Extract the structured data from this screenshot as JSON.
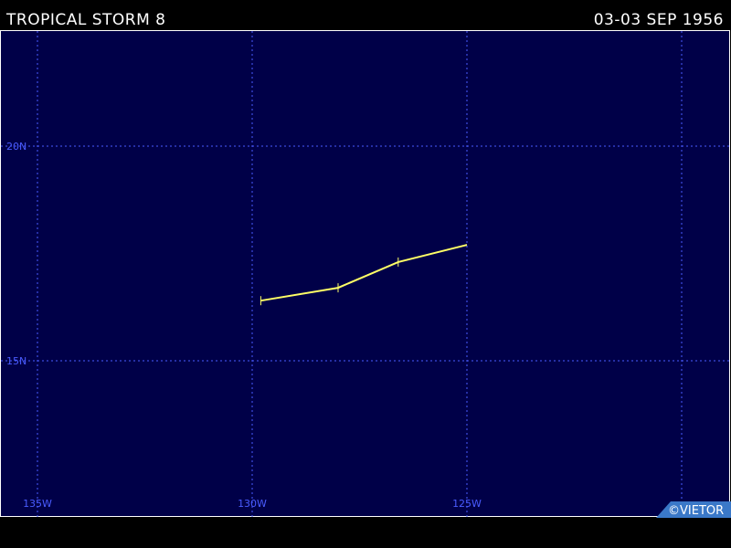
{
  "header": {
    "storm_name": "TROPICAL STORM 8",
    "date_range": "03-03 SEP 1956"
  },
  "map": {
    "lon_grid": [
      {
        "value": -135,
        "label": "135W"
      },
      {
        "value": -130,
        "label": "130W"
      },
      {
        "value": -125,
        "label": "125W"
      },
      {
        "value": -120,
        "label": ""
      }
    ],
    "lat_grid": [
      {
        "value": 20,
        "label": "20N"
      },
      {
        "value": 15,
        "label": "15N"
      }
    ],
    "track": [
      {
        "lon": -129.8,
        "lat": 16.4
      },
      {
        "lon": -128.0,
        "lat": 16.7
      },
      {
        "lon": -126.6,
        "lat": 17.3
      },
      {
        "lon": -125.0,
        "lat": 17.7
      }
    ],
    "track_color": "#ffff66",
    "background_color": "#000048",
    "grid_color": "#4a5cff"
  },
  "credit": {
    "text": "©VIETOR"
  }
}
